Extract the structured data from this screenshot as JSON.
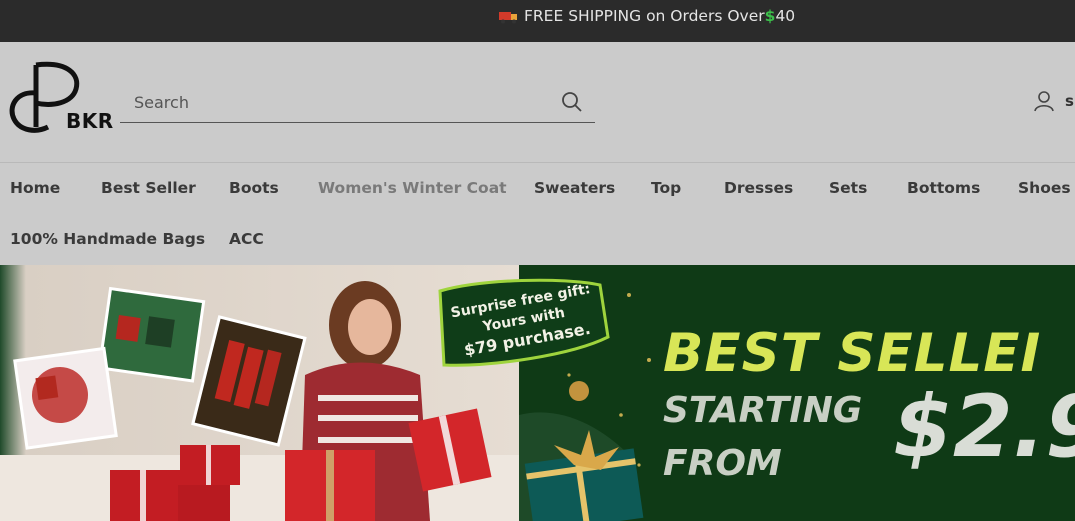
{
  "announcement": {
    "text": "FREE SHIPPING on Orders Over ",
    "currency": "$",
    "amount": "40"
  },
  "header": {
    "logo_text": "BKR",
    "search": {
      "placeholder": "Search",
      "value": ""
    },
    "account_label": "si"
  },
  "nav": {
    "items": [
      {
        "label": "Home"
      },
      {
        "label": "Best Seller"
      },
      {
        "label": "Boots"
      },
      {
        "label": "Women's Winter Coat"
      },
      {
        "label": "Sweaters"
      },
      {
        "label": "Top"
      },
      {
        "label": "Dresses"
      },
      {
        "label": "Sets"
      },
      {
        "label": "Bottoms"
      },
      {
        "label": "Shoes"
      },
      {
        "label": "100% Handmade Bags"
      },
      {
        "label": "ACC"
      }
    ]
  },
  "hero": {
    "badge_line1": "Surprise free gift:",
    "badge_line2": "Yours with",
    "badge_line3": "$79 purchase.",
    "headline": "BEST SELLEI",
    "starting": "STARTING",
    "from": "FROM",
    "price": "$2.9"
  },
  "colors": {
    "topbar_bg": "#2b2b2b",
    "header_bg": "#cbcbcb",
    "hero_green": "#0f3a16",
    "headline_yellow": "#d8e657",
    "dollar_green": "#3cbf4b"
  }
}
